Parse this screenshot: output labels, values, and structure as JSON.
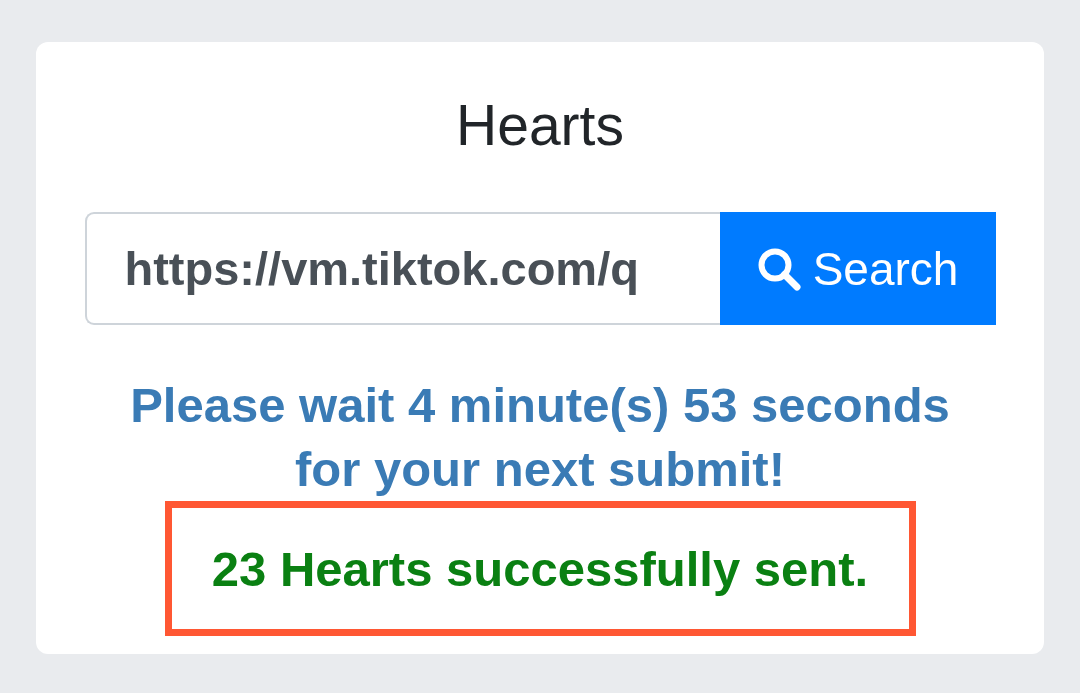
{
  "card": {
    "title": "Hearts",
    "url_field": {
      "value": "https://vm.tiktok.com/q"
    },
    "search_button": {
      "label": "Search"
    },
    "wait_message": "Please wait 4 minute(s) 53 seconds for your next submit!",
    "success_message": {
      "text": "23 Hearts successfully sent.",
      "highlighted": true
    }
  }
}
